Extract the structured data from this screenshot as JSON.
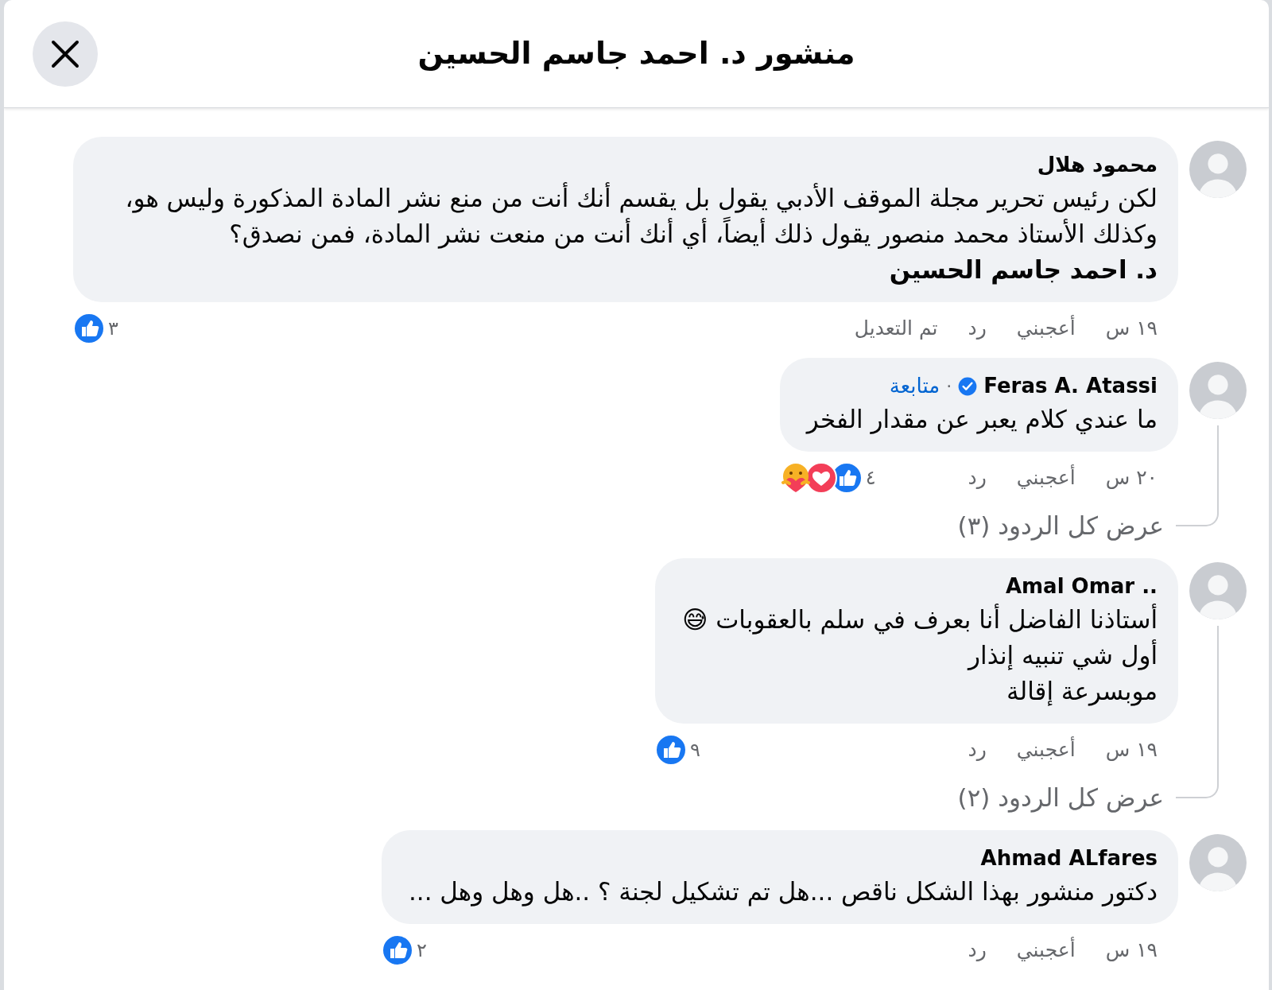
{
  "window": {
    "title": "منشور د. احمد جاسم الحسين"
  },
  "comments": [
    {
      "author": "محمود هلال",
      "text": "لكن رئيس تحرير مجلة الموقف الأدبي يقول بل يقسم أنك أنت من منع نشر المادة المذكورة وليس هو، وكذلك الأستاذ محمد منصور يقول ذلك أيضاً، أي أنك أنت من منعت نشر المادة، فمن نصدق؟\n**د. احمد جاسم الحسين**",
      "time": "١٩ س",
      "like_label": "أعجبني",
      "reply_label": "رد",
      "edited_label": "تم التعديل",
      "reactions": {
        "count": "٣",
        "icons": [
          {
            "kind": "like"
          }
        ]
      }
    },
    {
      "author": "Feras A. Atassi",
      "verified": true,
      "separator": "·",
      "follow_label": "متابعة",
      "text": "ما عندي كلام يعبر عن مقدار الفخر",
      "time": "٢٠ س",
      "like_label": "أعجبني",
      "reply_label": "رد",
      "reactions": {
        "count": "٤",
        "icons": [
          {
            "kind": "like"
          },
          {
            "kind": "love"
          },
          {
            "kind": "care"
          }
        ]
      },
      "replies_label": "عرض كل الردود (٣)"
    },
    {
      "author": ".. Amal Omar",
      "text": "أستاذنا الفاضل أنا بعرف في سلم بالعقوبات 😅\nأول شي تنبيه إنذار\nموبسرعة إقالة",
      "time": "١٩ س",
      "like_label": "أعجبني",
      "reply_label": "رد",
      "reactions": {
        "count": "٩",
        "icons": [
          {
            "kind": "like"
          }
        ]
      },
      "replies_label": "عرض كل الردود (٢)"
    },
    {
      "author": "Ahmad ALfares",
      "text": "دكتور منشور بهذا الشكل ناقص ...هل تم تشكيل لجنة ؟ ..هل وهل وهل ...",
      "time": "١٩ س",
      "like_label": "أعجبني",
      "reply_label": "رد",
      "reactions": {
        "count": "٢",
        "icons": [
          {
            "kind": "like"
          }
        ]
      }
    }
  ]
}
